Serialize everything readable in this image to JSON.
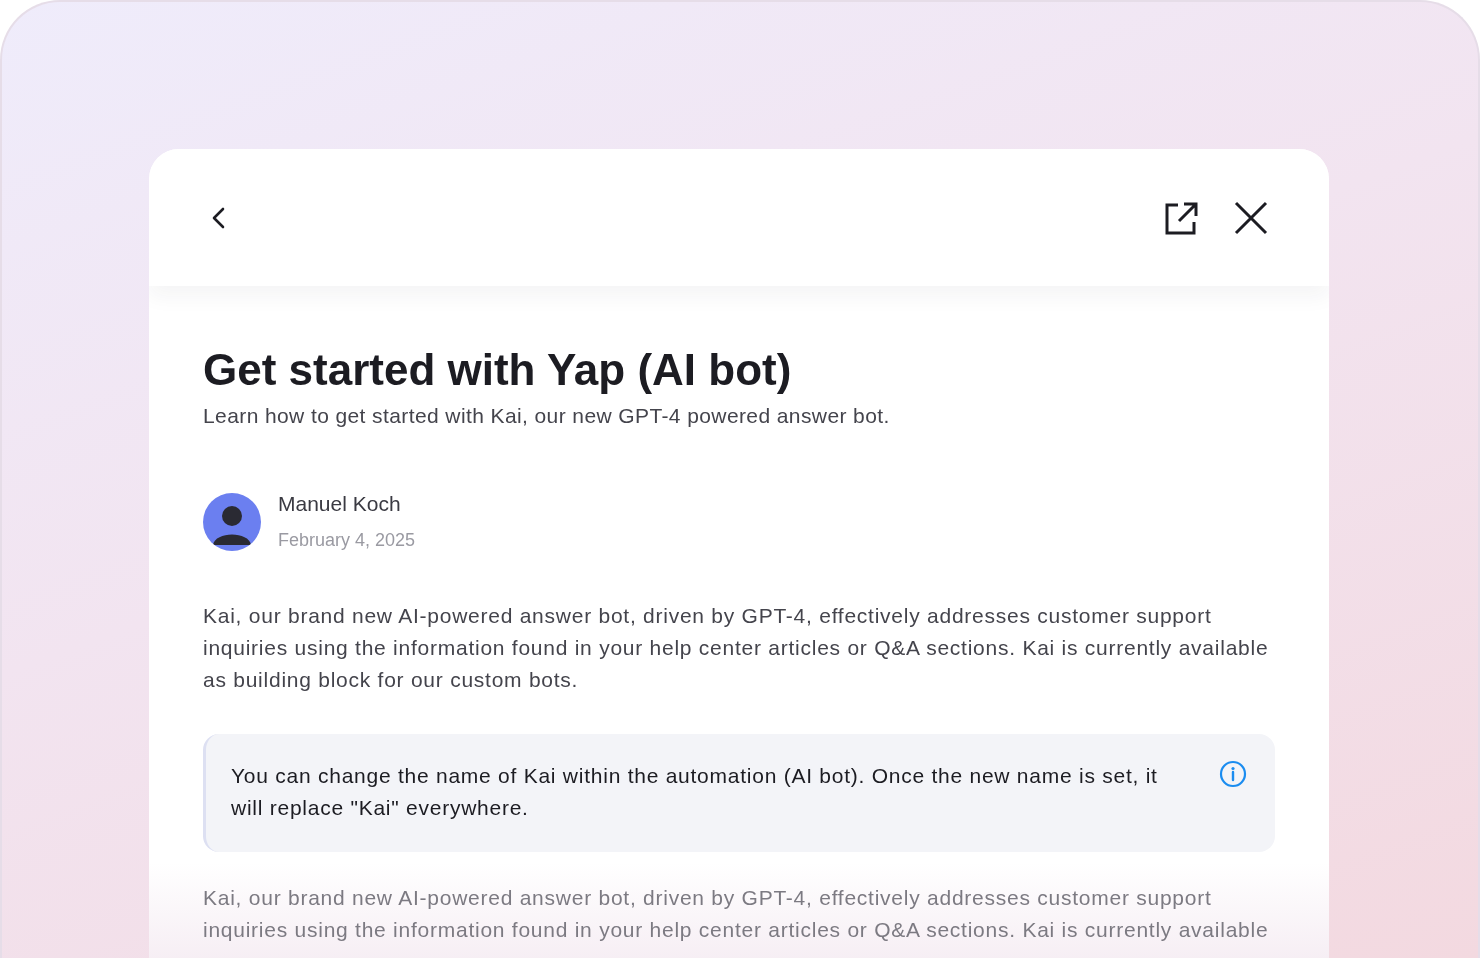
{
  "article": {
    "title": "Get started with Yap (AI bot)",
    "subtitle": "Learn how to get started with Kai, our new GPT-4 powered answer bot.",
    "author": {
      "name": "Manuel Koch",
      "date": "February 4, 2025"
    },
    "blocks": [
      {
        "kind": "paragraph",
        "text": "Kai, our brand new AI-powered answer bot, driven by GPT-4, effectively addresses customer support inquiries using the information found in your help center articles or Q&A sections. Kai is currently available as building block for our custom bots."
      },
      {
        "kind": "callout",
        "text": "You can change the name of Kai within the automation (AI bot). Once the new name is set, it will replace \"Kai\" everywhere."
      },
      {
        "kind": "faded",
        "text": "Kai, our brand new AI-powered answer bot, driven by GPT-4, effectively addresses customer support inquiries using the information found in your help center articles or Q&A sections. Kai is currently available"
      }
    ]
  }
}
